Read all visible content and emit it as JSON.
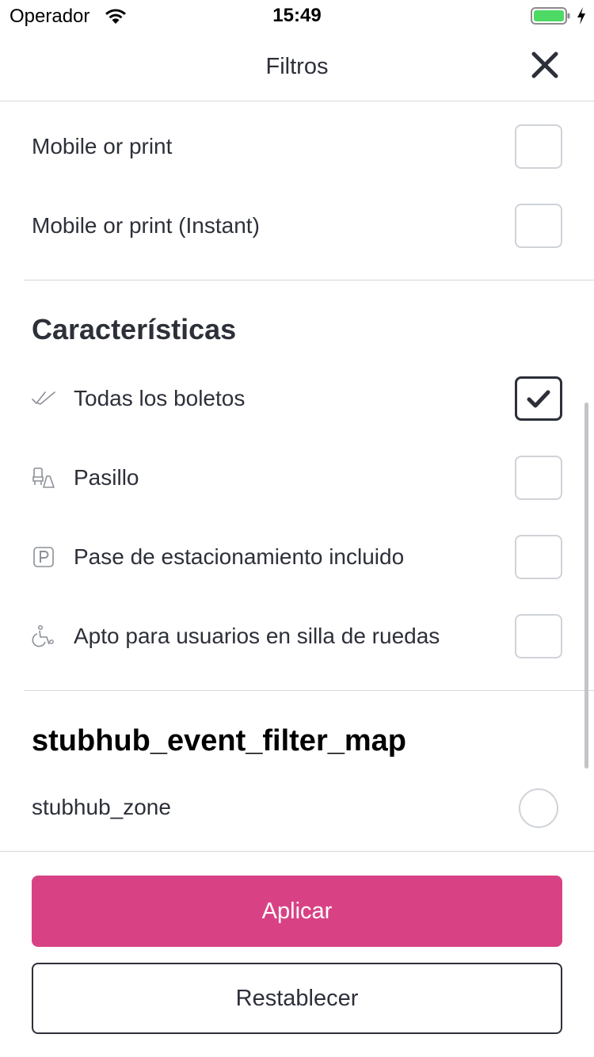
{
  "status_bar": {
    "carrier": "Operador",
    "time": "15:49",
    "wifi_icon": "wifi-icon",
    "battery_icon": "battery-icon",
    "battery_color": "#4cd964"
  },
  "header": {
    "title": "Filtros",
    "close_icon": "close-icon"
  },
  "delivery": {
    "options": [
      {
        "label": "Mobile or print",
        "checked": false
      },
      {
        "label": "Mobile or print (Instant)",
        "checked": false
      }
    ]
  },
  "features": {
    "title": "Características",
    "options": [
      {
        "label": "Todas los boletos",
        "icon": "double-check-icon",
        "checked": true
      },
      {
        "label": "Pasillo",
        "icon": "aisle-seat-icon",
        "checked": false
      },
      {
        "label": "Pase de estacionamiento incluido",
        "icon": "parking-icon",
        "checked": false
      },
      {
        "label": "Apto para usuarios en silla de ruedas",
        "icon": "wheelchair-icon",
        "checked": false
      }
    ]
  },
  "map_filter": {
    "title": "stubhub_event_filter_map",
    "options": [
      {
        "label": "stubhub_zone",
        "selected": false
      }
    ]
  },
  "footer": {
    "apply_label": "Aplicar",
    "reset_label": "Restablecer",
    "accent_color": "#d84285"
  }
}
